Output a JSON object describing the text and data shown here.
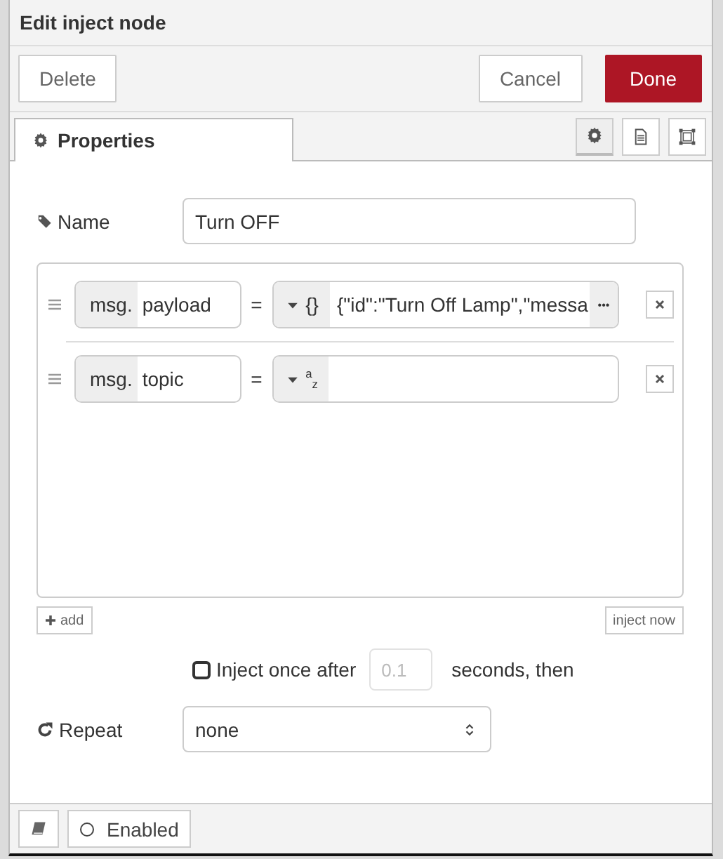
{
  "window": {
    "title": "Edit inject node"
  },
  "toolbar": {
    "buttons": [
      {
        "label": "Delete",
        "kind": "plain"
      },
      {
        "label": "Cancel",
        "kind": "plain"
      },
      {
        "label": "Done",
        "kind": "primary"
      }
    ]
  },
  "tabs": [
    {
      "label": "Properties",
      "selected": true
    }
  ],
  "tab_icons": [
    {
      "kind": "gear",
      "selected": true
    },
    {
      "kind": "document",
      "selected": false
    },
    {
      "kind": "frame",
      "selected": false
    }
  ],
  "name_field": {
    "label": "Name",
    "value": "Turn OFF"
  },
  "properties": [
    {
      "prefix": "msg.",
      "property": "payload",
      "operator": "=",
      "kind": "json",
      "type_label": "{}",
      "value": "{\"id\":\"Turn Off Lamp\",\"messa",
      "expand": "•••"
    },
    {
      "prefix": "msg.",
      "property": "topic",
      "operator": "=",
      "kind": "string",
      "type_label": "$^{a}$$_{z}$"
    }
  ],
  "add_button": "add",
  "inject_now_button": "inject now",
  "inject_once": {
    "checked": false,
    "label": "Inject once after",
    "placeholder": "0.1",
    "suffix": "seconds, then"
  },
  "repeat": {
    "label": "Repeat",
    "value": "none"
  },
  "footer": {
    "enabled": {
      "label": "Enabled",
      "on": false
    }
  }
}
